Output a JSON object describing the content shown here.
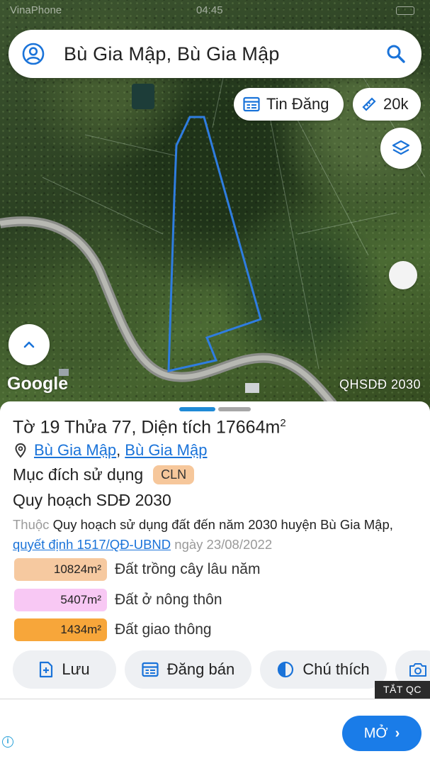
{
  "status_bar": {
    "carrier": "VinaPhone",
    "time": "04:45"
  },
  "search": {
    "query": "Bù Gia Mập, Bù Gia Mập"
  },
  "map": {
    "listing_chip": "Tin Đăng",
    "scale_chip": "20k",
    "watermark": "Google",
    "plan_badge": "QHSDĐ 2030"
  },
  "parcel": {
    "title_main": "Tờ 19 Thửa 77, Diện tích 17664m",
    "title_unit_sup": "2",
    "location": {
      "commune": "Bù Gia Mập",
      "separator": ",",
      "district": "Bù Gia Mập"
    },
    "usage_label": "Mục đích sử dụng",
    "usage_code": "CLN",
    "plan_heading": "Quy hoạch SDĐ 2030",
    "plan_prefix": "Thuộc",
    "plan_name": "Quy hoạch sử dụng đất đến năm 2030 huyện Bù Gia Mập,",
    "plan_decision": "quyết định 1517/QĐ-UBND",
    "plan_date": "ngày 23/08/2022",
    "areas": [
      {
        "value": "10824m²",
        "label": "Đất trồng cây lâu năm",
        "color": "#f6c9a0"
      },
      {
        "value": "5407m²",
        "label": "Đất ở nông thôn",
        "color": "#f8c8f4"
      },
      {
        "value": "1434m²",
        "label": "Đất giao thông",
        "color": "#f7a63a"
      }
    ]
  },
  "actions": {
    "save": "Lưu",
    "post": "Đăng bán",
    "legend": "Chú thích"
  },
  "ad": {
    "close_label": "TẮT QC",
    "open_label": "MỞ"
  },
  "colors": {
    "accent": "#1a73d9",
    "boundary": "#2f7de0"
  }
}
